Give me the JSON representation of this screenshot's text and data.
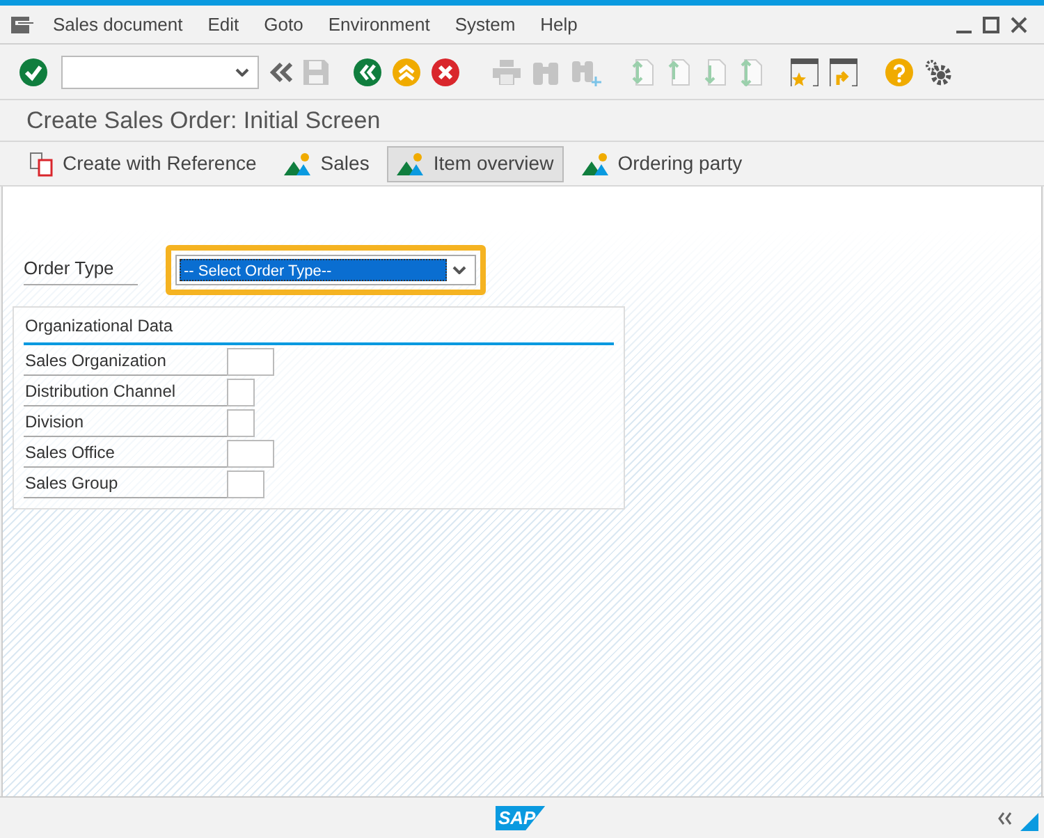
{
  "menu_bar": [
    "Sales document",
    "Edit",
    "Goto",
    "Environment",
    "System",
    "Help"
  ],
  "toolbar": [
    {
      "kind": "enter",
      "disabled": false
    },
    {
      "kind": "command-field"
    },
    {
      "kind": "chevrons",
      "disabled": false
    },
    {
      "kind": "save",
      "disabled": true
    },
    {
      "kind": "back",
      "disabled": false
    },
    {
      "kind": "exit",
      "disabled": false
    },
    {
      "kind": "cancel",
      "disabled": false
    },
    {
      "kind": "print",
      "disabled": true
    },
    {
      "kind": "find",
      "disabled": true
    },
    {
      "kind": "find-next",
      "disabled": true
    },
    {
      "kind": "first-page",
      "disabled": true
    },
    {
      "kind": "previous-page",
      "disabled": true
    },
    {
      "kind": "next-page",
      "disabled": true
    },
    {
      "kind": "last-page",
      "disabled": true
    },
    {
      "kind": "new-session",
      "disabled": false
    },
    {
      "kind": "shortcut",
      "disabled": false
    },
    {
      "kind": "help",
      "disabled": false
    },
    {
      "kind": "settings",
      "disabled": false
    }
  ],
  "screen_title": "Create Sales Order: Initial Screen",
  "app_toolbar": [
    {
      "label": "Create with Reference",
      "kind": "document",
      "selected": false
    },
    {
      "label": "Sales",
      "kind": "mountain",
      "selected": false
    },
    {
      "label": "Item overview",
      "kind": "mountain",
      "selected": true
    },
    {
      "label": "Ordering party",
      "kind": "mountain",
      "selected": false
    }
  ],
  "order_type": {
    "label": "Order Type",
    "value": "-- Select Order Type--",
    "highlighted": true
  },
  "organizational_data": {
    "title": "Organizational Data",
    "fields": [
      {
        "label": "Sales Organization"
      },
      {
        "label": "Distribution Channel"
      },
      {
        "label": "Division"
      },
      {
        "label": "Sales Office"
      },
      {
        "label": "Sales Group"
      }
    ]
  },
  "status_bar": {
    "logo": "SAP"
  }
}
